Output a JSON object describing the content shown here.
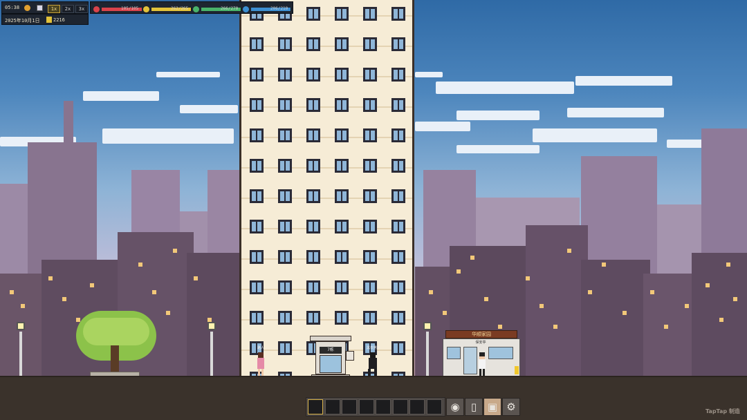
{
  "hud": {
    "time": "05:38",
    "speed_options": [
      "1x",
      "2x",
      "3x"
    ],
    "speed_selected": "1x",
    "date": "2025年10月1日",
    "money": "2216",
    "stats": [
      {
        "name": "health",
        "icon": "heart-icon",
        "text": "105/105",
        "fill": 1.0,
        "color": "#d9434b"
      },
      {
        "name": "hunger",
        "icon": "bread-icon",
        "text": "262/265",
        "fill": 0.99,
        "color": "#e2c23a"
      },
      {
        "name": "stamina",
        "icon": "drumstick-icon",
        "text": "266/270",
        "fill": 0.985,
        "color": "#49b36a"
      },
      {
        "name": "mood",
        "icon": "smile-icon",
        "text": "206/210",
        "fill": 0.98,
        "color": "#3d8fd1"
      }
    ]
  },
  "scene": {
    "tower_door_sign": "7栋",
    "booth_sign": "华顺家园",
    "booth_subsign": "保安亭",
    "npc_label_girl": "路人",
    "npc_label_man": "黑衣男子"
  },
  "hotbar": {
    "slots": 8,
    "tools": [
      "person-icon",
      "phone-icon",
      "backpack-icon",
      "gear-icon"
    ]
  },
  "watermark": "TapTap 制造"
}
